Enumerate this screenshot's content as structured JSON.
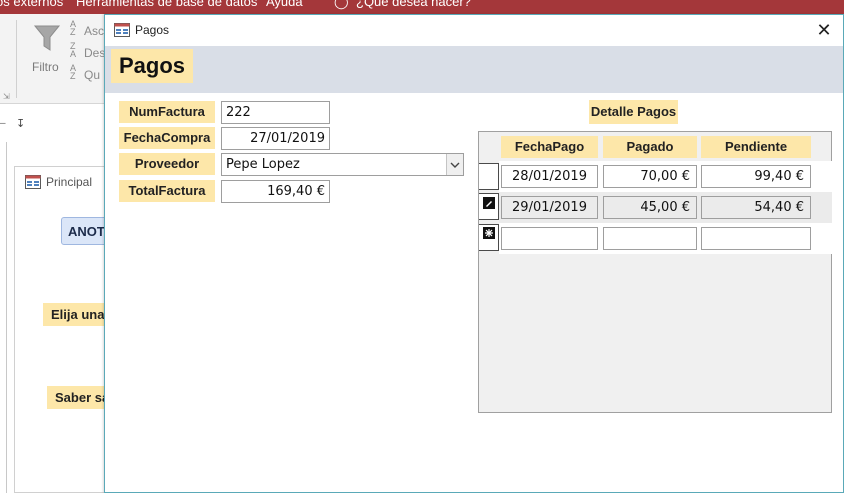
{
  "ribbon": {
    "tabs": [
      "os externos",
      "Herramientas de base de datos",
      "Ayuda",
      "¿Qué desea hacer?"
    ],
    "filter_label": "Filtro",
    "sort_items": [
      "Asc",
      "Des",
      "Qu"
    ]
  },
  "principal": {
    "title": "Principal",
    "anota_button": "ANOTA",
    "elija_label": "Elija una",
    "saber_label": "Saber sa"
  },
  "pagos_window": {
    "title": "Pagos",
    "close_symbol": "✕",
    "form_title": "Pagos",
    "fields": {
      "numfactura_label": "NumFactura",
      "numfactura_value": "222",
      "fechacompra_label": "FechaCompra",
      "fechacompra_value": "27/01/2019",
      "proveedor_label": "Proveedor",
      "proveedor_value": "Pepe Lopez",
      "totalfactura_label": "TotalFactura",
      "totalfactura_value": "169,40 €"
    },
    "detalle": {
      "label": "Detalle Pagos",
      "columns": [
        "FechaPago",
        "Pagado",
        "Pendiente"
      ],
      "rows": [
        {
          "fecha": "28/01/2019",
          "pagado": "70,00 €",
          "pendiente": "99,40 €"
        },
        {
          "fecha": "29/01/2019",
          "pagado": "45,00 €",
          "pendiente": "54,40 €"
        },
        {
          "fecha": "",
          "pagado": "",
          "pendiente": ""
        }
      ]
    }
  },
  "colors": {
    "ribbon": "#a4373a",
    "label_bg": "#fde7a9",
    "header_band": "#d9dee7",
    "window_border": "#5aa9b8"
  }
}
